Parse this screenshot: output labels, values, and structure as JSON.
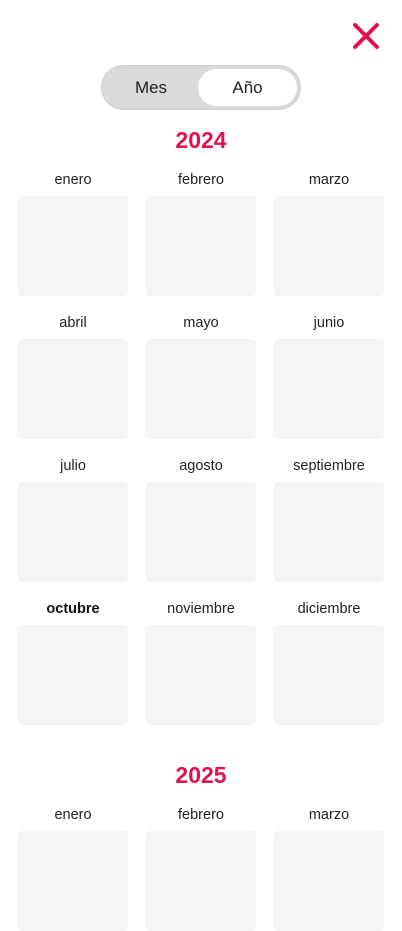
{
  "close": {
    "icon": "close-icon",
    "color": "#e0134f"
  },
  "toggle": {
    "options": [
      "Mes",
      "Año"
    ],
    "selected": "Año"
  },
  "years": [
    {
      "year": "2024",
      "months": [
        "enero",
        "febrero",
        "marzo",
        "abril",
        "mayo",
        "junio",
        "julio",
        "agosto",
        "septiembre",
        "octubre",
        "noviembre",
        "diciembre"
      ],
      "current_month": "octubre"
    },
    {
      "year": "2025",
      "months": [
        "enero",
        "febrero",
        "marzo"
      ]
    }
  ],
  "colors": {
    "accent": "#e0134f",
    "month_tile": "#f4f4f4",
    "toggle_track": "#d9d9d9"
  }
}
